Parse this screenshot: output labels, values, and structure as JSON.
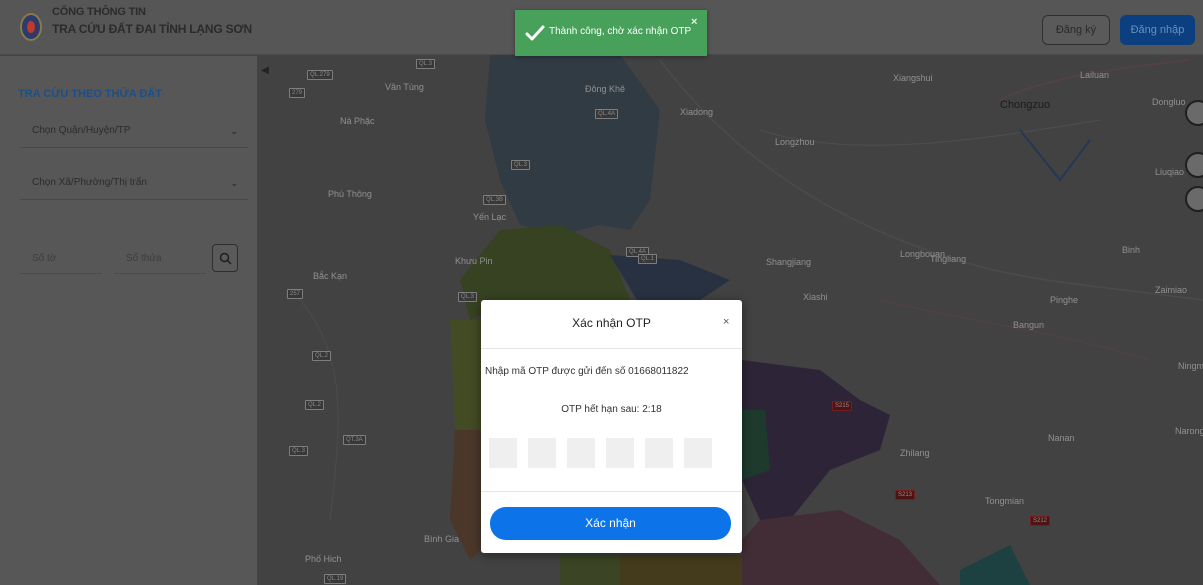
{
  "header": {
    "brand_line1": "CỔNG THÔNG TIN",
    "brand_line2": "TRA CỨU ĐẤT ĐAI TỈNH LẠNG SƠN",
    "register_label": "Đăng ký",
    "login_label": "Đăng nhập"
  },
  "sidebar": {
    "title": "TRA CỨU THEO THỬA ĐẤT",
    "district_select": "Chọn Quận/Huyện/TP",
    "commune_select": "Chọn Xã/Phường/Thị trấn",
    "sheet_placeholder": "Số tờ",
    "parcel_placeholder": "Số thửa",
    "collapse_label": "◀"
  },
  "toast": {
    "message": "Thành công, chờ xác nhận OTP",
    "close": "×"
  },
  "modal": {
    "title": "Xác nhận OTP",
    "close": "×",
    "instruction": "Nhập mã OTP được gửi đến số 01668011822",
    "expire_text": "OTP hết hạn sau: 2:18",
    "otp_digits": [
      "",
      "",
      "",
      "",
      "",
      ""
    ],
    "confirm_label": "Xác nhận"
  },
  "map": {
    "labels": [
      {
        "text": "Vân Tùng"
      },
      {
        "text": "Nà Phặc"
      },
      {
        "text": "Phú Thông"
      },
      {
        "text": "Bắc Kạn"
      },
      {
        "text": "Yến Lạc"
      },
      {
        "text": "Khưu Pin"
      },
      {
        "text": "Đông Khê"
      },
      {
        "text": "Xiangshui"
      },
      {
        "text": "Chongzuo"
      },
      {
        "text": "Lailuan"
      },
      {
        "text": "Dongluo"
      },
      {
        "text": "Longzhou"
      },
      {
        "text": "Shangjiang"
      },
      {
        "text": "Xiashi"
      },
      {
        "text": "Tingliang"
      },
      {
        "text": "Longbouan"
      },
      {
        "text": "Bangun"
      },
      {
        "text": "Liuqiao"
      },
      {
        "text": "Zaimiao"
      },
      {
        "text": "Binh"
      },
      {
        "text": "Ningming"
      },
      {
        "text": "Pinghe"
      },
      {
        "text": "Zhilang"
      },
      {
        "text": "Tongmian"
      },
      {
        "text": "Nanan"
      },
      {
        "text": "Narong"
      },
      {
        "text": "Phố Hich"
      },
      {
        "text": "Bình Gia"
      },
      {
        "text": "Xiadong"
      }
    ],
    "roads": [
      "QL.279",
      "QL.3",
      "279",
      "QL.3B",
      "QL.4A",
      "QL.4A",
      "QL.1",
      "QL.3",
      "257",
      "QL.3",
      "QL.2",
      "QL.2",
      "QT.3A",
      "QL.3",
      "QL.19",
      "S213",
      "S215",
      "S212"
    ]
  },
  "colors": {
    "toast_green": "#47a15a",
    "confirm_blue": "#0d73e8",
    "login_blue": "#0b3f80",
    "sidebar_title": "#1c4f8a"
  },
  "icons": [
    "check-icon",
    "close-icon",
    "search-icon",
    "chevron-down-icon",
    "layers-icon",
    "menu-icon",
    "document-icon"
  ]
}
